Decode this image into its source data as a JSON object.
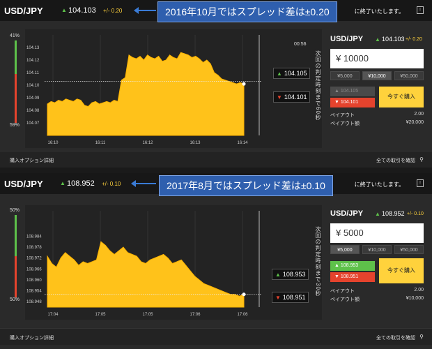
{
  "panels": [
    {
      "pair": "USD/JPY",
      "header_price": "104.103",
      "header_spread": "+/- 0.20",
      "callout": "2016年10月ではスプレッド差は±0.20",
      "end_text": "に終了いたします。",
      "sentiment": {
        "up_pct": "41%",
        "down_pct": "59%",
        "up_fraction": 0.41
      },
      "timer": "00:56",
      "expiry_vertical": "次回の判定時刻まで60秒",
      "high_tag": "104.105",
      "low_tag": "104.101",
      "right": {
        "pair": "USD/JPY",
        "price": "104.103",
        "spread": "+/- 0.20",
        "amount": "¥ 10000",
        "presets": [
          "¥5,000",
          "¥10,000",
          "¥50,000"
        ],
        "selected_preset": 1,
        "high_btn": "104.105",
        "low_btn": "104.101",
        "buy_label": "今すぐ購入",
        "payout_label": "ペイアウト",
        "payout_value": "2.00",
        "payout_amount_label": "ペイアウト額",
        "payout_amount_value": "¥20,000"
      },
      "footer_left": "購入オプション詳細",
      "footer_right": "全ての取引を確認"
    },
    {
      "pair": "USD/JPY",
      "header_price": "108.952",
      "header_spread": "+/- 0.10",
      "callout": "2017年8月ではスプレッド差は±0.10",
      "end_text": "に終了いたします。",
      "sentiment": {
        "up_pct": "50%",
        "down_pct": "50%",
        "up_fraction": 0.5
      },
      "timer": "",
      "expiry_vertical": "次回の判定時刻まで30秒",
      "high_tag": "108.953",
      "low_tag": "108.951",
      "right": {
        "pair": "USD/JPY",
        "price": "108.952",
        "spread": "+/- 0.10",
        "amount": "¥ 5000",
        "presets": [
          "¥5,000",
          "¥10,000",
          "¥50,000"
        ],
        "selected_preset": 0,
        "high_btn": "108.953",
        "low_btn": "108.951",
        "buy_label": "今すぐ購入",
        "payout_label": "ペイアウト",
        "payout_value": "2.00",
        "payout_amount_label": "ペイアウト額",
        "payout_amount_value": "¥10,000"
      },
      "footer_left": "購入オプション詳細",
      "footer_right": "全ての取引を確認"
    }
  ],
  "colors": {
    "area": "#ffc21a",
    "area_edge": "#ffb300",
    "up": "#5ec14a",
    "down": "#e5432d",
    "accent": "#ffd23c"
  },
  "chart_data": [
    {
      "type": "area",
      "ylim": [
        104.06,
        104.14
      ],
      "yticks": [
        "104.13",
        "104.12",
        "104.11",
        "104.10",
        "104.09",
        "104.08",
        "104.07"
      ],
      "xticks": [
        "16:10",
        "16:11",
        "16:12",
        "16:13",
        "16:14"
      ],
      "strike": 104.103,
      "series": [
        {
          "values": [
            104.085,
            104.087,
            104.086,
            104.088,
            104.087,
            104.089,
            104.088,
            104.087,
            104.089,
            104.088,
            104.084,
            104.083,
            104.086,
            104.087,
            104.085,
            104.086,
            104.087,
            104.086,
            104.088,
            104.087,
            104.104,
            104.106,
            104.124,
            104.122,
            104.121,
            104.123,
            104.12,
            104.124,
            104.122,
            104.121,
            104.123,
            104.119,
            104.12,
            104.124,
            104.122,
            104.121,
            104.126,
            104.125,
            104.124,
            104.122,
            104.123,
            104.121,
            104.118,
            104.12,
            104.117,
            104.11,
            104.108,
            104.105,
            104.104,
            104.103,
            104.102,
            104.101,
            104.102,
            104.101
          ]
        }
      ]
    },
    {
      "type": "area",
      "ylim": [
        108.945,
        108.998
      ],
      "yticks": [
        "108.984",
        "108.978",
        "108.972",
        "108.966",
        "108.960",
        "108.954",
        "108.948"
      ],
      "xticks": [
        "17:04",
        "17:05",
        "17:05",
        "17:06",
        "17:06"
      ],
      "strike": 108.952,
      "series": [
        {
          "values": [
            108.973,
            108.969,
            108.967,
            108.972,
            108.975,
            108.973,
            108.971,
            108.968,
            108.97,
            108.969,
            108.97,
            108.971,
            108.981,
            108.979,
            108.976,
            108.974,
            108.976,
            108.978,
            108.975,
            108.974,
            108.973,
            108.97,
            108.969,
            108.971,
            108.972,
            108.973,
            108.974,
            108.972,
            108.969,
            108.97,
            108.971,
            108.968,
            108.965,
            108.962,
            108.96,
            108.958,
            108.957,
            108.956,
            108.955,
            108.954,
            108.953,
            108.952,
            108.952,
            108.951,
            108.952
          ]
        }
      ]
    }
  ]
}
